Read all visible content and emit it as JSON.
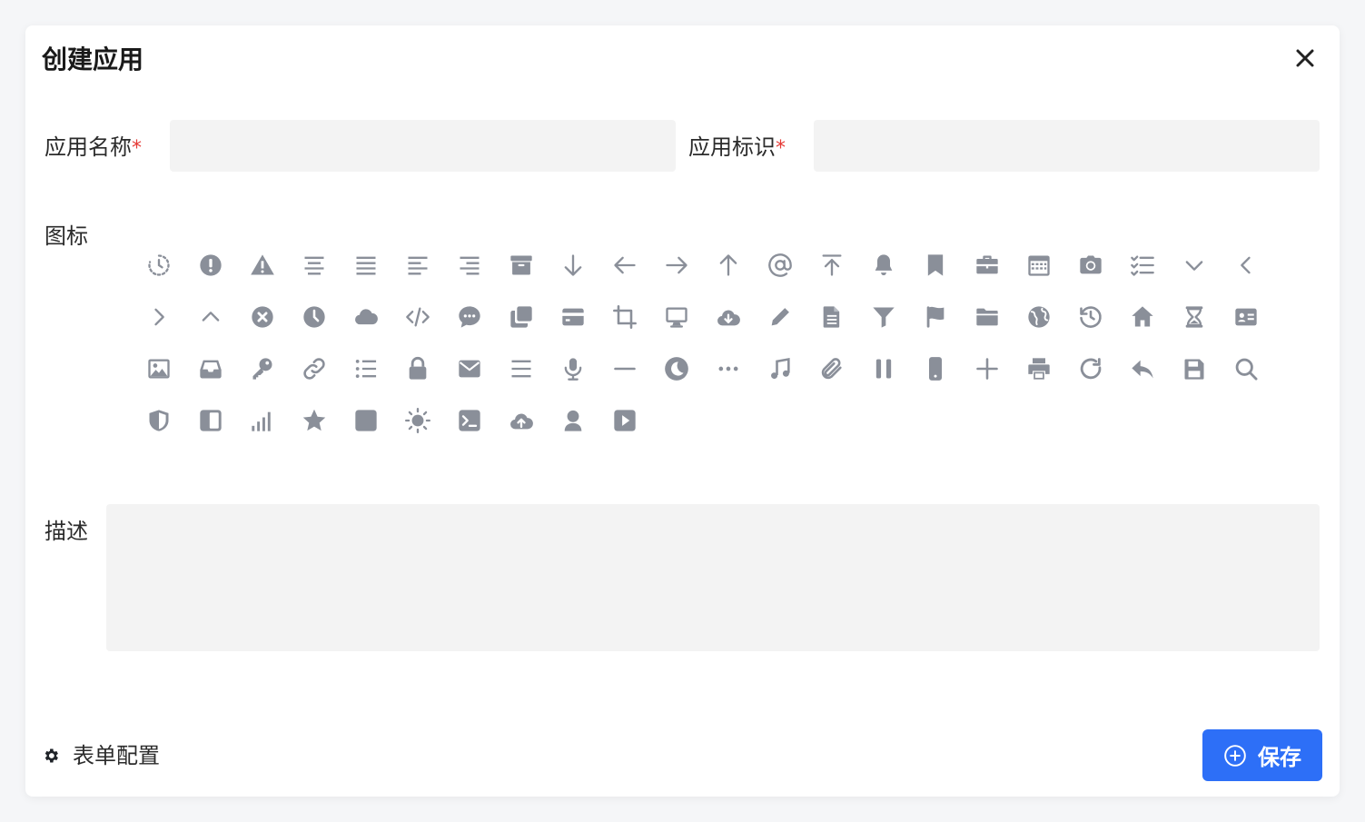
{
  "dialog": {
    "title": "创建应用",
    "close_icon": "close-icon"
  },
  "form": {
    "app_name": {
      "label": "应用名称",
      "required_mark": "*",
      "value": "",
      "placeholder": ""
    },
    "app_id": {
      "label": "应用标识",
      "required_mark": "*",
      "value": "",
      "placeholder": ""
    },
    "icon": {
      "label": "图标"
    },
    "description": {
      "label": "描述",
      "value": "",
      "placeholder": ""
    }
  },
  "icons": [
    "history-dashed-icon",
    "exclamation-circle-icon",
    "warning-triangle-icon",
    "align-center-icon",
    "align-justify-icon",
    "align-left-icon",
    "align-right-icon",
    "archive-icon",
    "arrow-down-icon",
    "arrow-left-icon",
    "arrow-right-icon",
    "arrow-up-icon",
    "at-sign-icon",
    "arrow-to-top-icon",
    "bell-icon",
    "bookmark-icon",
    "briefcase-icon",
    "calendar-icon",
    "camera-icon",
    "checklist-icon",
    "chevron-down-icon",
    "chevron-left-icon",
    "chevron-right-icon",
    "chevron-up-icon",
    "x-circle-icon",
    "clock-icon",
    "cloud-icon",
    "code-icon",
    "chat-bubble-icon",
    "copy-icon",
    "credit-card-icon",
    "crop-icon",
    "desktop-icon",
    "cloud-download-icon",
    "pencil-icon",
    "document-icon",
    "filter-icon",
    "flag-icon",
    "folder-icon",
    "globe-icon",
    "history-icon",
    "home-icon",
    "hourglass-icon",
    "id-card-icon",
    "image-icon",
    "inbox-icon",
    "key-icon",
    "link-icon",
    "list-icon",
    "lock-icon",
    "mail-icon",
    "menu-icon",
    "microphone-icon",
    "minus-icon",
    "moon-icon",
    "ellipsis-icon",
    "music-icon",
    "paperclip-icon",
    "pause-icon",
    "mobile-phone-icon",
    "plus-icon",
    "printer-icon",
    "refresh-icon",
    "reply-icon",
    "save-icon",
    "search-icon",
    "shield-icon",
    "sidebar-icon",
    "signal-icon",
    "star-icon",
    "square-icon",
    "sun-icon",
    "terminal-icon",
    "cloud-upload-icon",
    "user-icon",
    "play-icon"
  ],
  "footer": {
    "config_label": "表单配置",
    "config_icon": "gear-icon",
    "save_label": "保存",
    "save_icon": "plus-circle-icon"
  },
  "colors": {
    "accent": "#2d6ff7",
    "icon": "#8a8f99",
    "required": "#e53935",
    "input_bg": "#f3f3f3"
  }
}
